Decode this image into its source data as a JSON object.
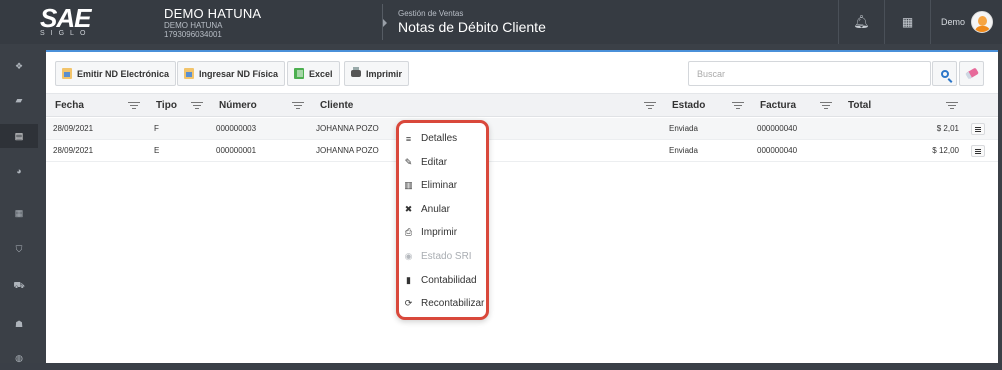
{
  "app": {
    "logo_main": "SAE",
    "logo_sub": "SIGLO",
    "company_name": "DEMO HATUNA",
    "company_sub": "DEMO HATUNA",
    "company_ruc": "1793096034001",
    "module_section": "Gestión de Ventas",
    "module_title": "Notas de Débito Cliente",
    "user_name": "Demo"
  },
  "topbar_icons": [
    "bell-icon",
    "apps-grid-icon"
  ],
  "sidebar": {
    "items": [
      {
        "icon": "dashboard-icon",
        "glyph": "❖"
      },
      {
        "icon": "truck-icon",
        "glyph": "▰"
      },
      {
        "icon": "invoice-icon",
        "glyph": "▤",
        "active": true
      },
      {
        "icon": "pie-chart-icon",
        "glyph": "◕"
      },
      {
        "icon": "calendar-icon",
        "glyph": "▦"
      },
      {
        "icon": "shield-icon",
        "glyph": "⛉"
      },
      {
        "icon": "cart-icon",
        "glyph": "⛟"
      },
      {
        "icon": "user-icon",
        "glyph": "☗"
      },
      {
        "icon": "settings-icon",
        "glyph": "◍"
      }
    ]
  },
  "toolbar": {
    "emit_label": "Emitir ND Electrónica",
    "physical_label": "Ingresar ND Física",
    "excel_label": "Excel",
    "print_label": "Imprimir",
    "search_placeholder": "Buscar"
  },
  "table": {
    "headers": {
      "fecha": "Fecha",
      "tipo": "Tipo",
      "numero": "Número",
      "cliente": "Cliente",
      "estado": "Estado",
      "factura": "Factura",
      "total": "Total"
    },
    "rows": [
      {
        "fecha": "28/09/2021",
        "tipo": "F",
        "numero": "000000003",
        "cliente": "JOHANNA POZO",
        "estado": "Enviada",
        "factura": "000000040",
        "total": "$ 2,01"
      },
      {
        "fecha": "28/09/2021",
        "tipo": "E",
        "numero": "000000001",
        "cliente": "JOHANNA POZO",
        "estado": "Enviada",
        "factura": "000000040",
        "total": "$ 12,00"
      }
    ]
  },
  "context_menu": {
    "items": [
      {
        "label": "Detalles",
        "icon": "list-icon",
        "glyph": "≡",
        "disabled": false
      },
      {
        "label": "Editar",
        "icon": "pencil-icon",
        "glyph": "✎",
        "disabled": false
      },
      {
        "label": "Eliminar",
        "icon": "trash-icon",
        "glyph": "▥",
        "disabled": false
      },
      {
        "label": "Anular",
        "icon": "x-icon",
        "glyph": "✖",
        "disabled": false
      },
      {
        "label": "Imprimir",
        "icon": "printer-icon",
        "glyph": "⎙",
        "disabled": false
      },
      {
        "label": "Estado SRI",
        "icon": "globe-icon",
        "glyph": "◉",
        "disabled": true
      },
      {
        "label": "Contabilidad",
        "icon": "book-icon",
        "glyph": "▮",
        "disabled": false
      },
      {
        "label": "Recontabilizar",
        "icon": "retweet-icon",
        "glyph": "⟳",
        "disabled": false
      }
    ]
  },
  "colors": {
    "accent": "#4a90d9",
    "menu_highlight": "#d9483b",
    "topbar": "#363b42"
  }
}
